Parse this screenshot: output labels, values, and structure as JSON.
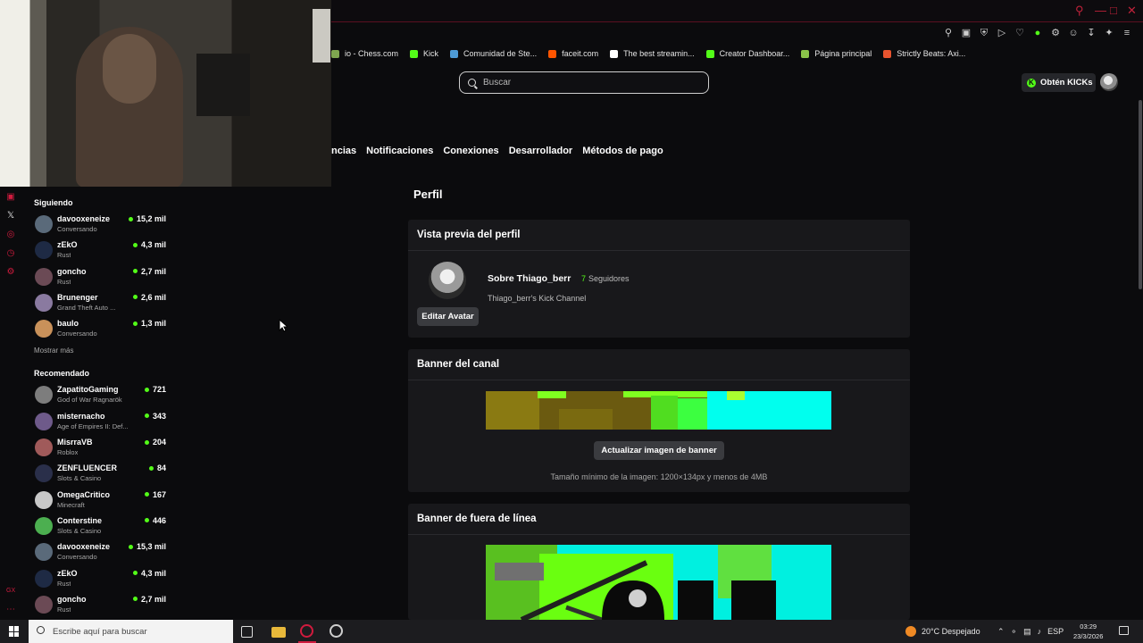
{
  "browser": {
    "bookmarks": [
      {
        "label": "io - Chess.com",
        "color": "#7fa650"
      },
      {
        "label": "Kick",
        "color": "#53fc18"
      },
      {
        "label": "Comunidad de Ste...",
        "color": "#4e9bd6"
      },
      {
        "label": "faceit.com",
        "color": "#ff5500"
      },
      {
        "label": "The best streamin...",
        "color": "#ffffff"
      },
      {
        "label": "Creator Dashboar...",
        "color": "#53fc18"
      },
      {
        "label": "Página principal",
        "color": "#8bc34a"
      },
      {
        "label": "Strictly Beats: Axi...",
        "color": "#e8542f"
      }
    ],
    "toolbar_icons": [
      "pin-icon",
      "screenshot-icon",
      "shield-icon",
      "play-icon",
      "heart-icon",
      "extension-icon",
      "puzzle-icon",
      "profile-icon",
      "download-icon",
      "ai-icon",
      "menu-icon"
    ]
  },
  "header": {
    "search_placeholder": "Buscar",
    "kicks_label": "Obtén KICKs"
  },
  "settings_tabs": [
    "ncias",
    "Notificaciones",
    "Conexiones",
    "Desarrollador",
    "Métodos de pago"
  ],
  "sidebar": {
    "following_title": "Siguiendo",
    "following": [
      {
        "name": "davooxeneize",
        "category": "Conversando",
        "viewers": "15,2 mil",
        "avatar": "#5a6a7a"
      },
      {
        "name": "zEkO",
        "category": "Rust",
        "viewers": "4,3 mil",
        "avatar": "#1e2a44"
      },
      {
        "name": "goncho",
        "category": "Rust",
        "viewers": "2,7 mil",
        "avatar": "#6b4a55"
      },
      {
        "name": "Brunenger",
        "category": "Grand Theft Auto ...",
        "viewers": "2,6 mil",
        "avatar": "#8a7aa0"
      },
      {
        "name": "baulo",
        "category": "Conversando",
        "viewers": "1,3 mil",
        "avatar": "#c9915a"
      }
    ],
    "show_more": "Mostrar más",
    "recommended_title": "Recomendado",
    "recommended": [
      {
        "name": "ZapatitoGaming",
        "category": "God of War Ragnarök",
        "viewers": "721",
        "avatar": "#7d7d7d"
      },
      {
        "name": "misternacho",
        "category": "Age of Empires II: Def...",
        "viewers": "343",
        "avatar": "#6e5a8a"
      },
      {
        "name": "MisrraVB",
        "category": "Roblox",
        "viewers": "204",
        "avatar": "#a05a5a"
      },
      {
        "name": "ZENFLUENCER",
        "category": "Slots & Casino",
        "viewers": "84",
        "avatar": "#2a2f4a"
      },
      {
        "name": "OmegaCritico",
        "category": "Minecraft",
        "viewers": "167",
        "avatar": "#c8c8c8"
      },
      {
        "name": "Conterstine",
        "category": "Slots & Casino",
        "viewers": "446",
        "avatar": "#4caf50"
      },
      {
        "name": "davooxeneize",
        "category": "Conversando",
        "viewers": "15,3 mil",
        "avatar": "#5a6a7a"
      },
      {
        "name": "zEkO",
        "category": "Rust",
        "viewers": "4,3 mil",
        "avatar": "#1e2a44"
      },
      {
        "name": "goncho",
        "category": "Rust",
        "viewers": "2,7 mil",
        "avatar": "#6b4a55"
      }
    ]
  },
  "main": {
    "page_title": "Perfil",
    "preview_title": "Vista previa del perfil",
    "about_name": "Sobre Thiago_berr",
    "followers_count": "7",
    "followers_label": "Seguidores",
    "channel_desc": "Thiago_berr's Kick Channel",
    "edit_avatar": "Editar Avatar",
    "banner_title": "Banner del canal",
    "update_banner": "Actualizar imagen de banner",
    "banner_hint": "Tamaño mínimo de la imagen: 1200×134px y menos de 4MB",
    "offline_title": "Banner de fuera de línea"
  },
  "taskbar": {
    "search_placeholder": "Escribe aquí para buscar",
    "weather": "20°C  Despejado",
    "lang": "ESP",
    "time": "03:29",
    "date": "23/3/2026"
  },
  "colors": {
    "accent": "#53fc18",
    "browser_red": "#d11b3e"
  }
}
